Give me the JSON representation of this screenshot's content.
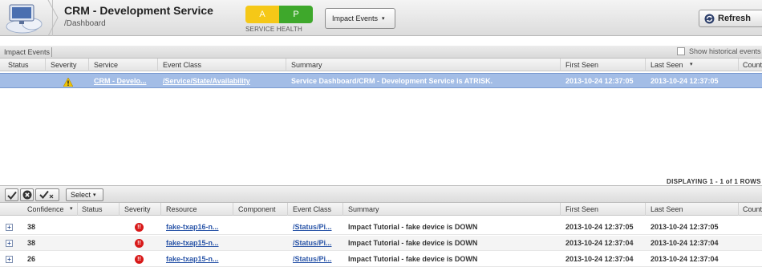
{
  "header": {
    "title": "CRM - Development Service",
    "subtitle": "/Dashboard",
    "health": {
      "a": "A",
      "p": "P",
      "label": "SERVICE HEALTH",
      "a_color": "#f5c817",
      "p_color": "#3ea82b"
    },
    "impact_button": "Impact Events",
    "refresh_button": "Refresh"
  },
  "events": {
    "section_title": "Impact Events",
    "historical_label": "Show historical events",
    "columns": [
      "Status",
      "Severity",
      "Service",
      "Event Class",
      "Summary",
      "First Seen",
      "Last Seen",
      "Count"
    ],
    "rows": [
      {
        "service": "CRM - Develo...",
        "event_class": "/Service/State/Availability",
        "summary": "Service Dashboard/CRM - Development Service is ATRISK.",
        "first_seen": "2013-10-24 12:37:05",
        "last_seen": "2013-10-24 12:37:05",
        "severity_icon": "warning-icon"
      }
    ],
    "paging": "DISPLAYING 1 - 1 of 1 ROWS"
  },
  "detail": {
    "select_button": "Select",
    "columns": [
      "Confidence",
      "Status",
      "Severity",
      "Resource",
      "Component",
      "Event Class",
      "Summary",
      "First Seen",
      "Last Seen",
      "Count"
    ],
    "rows": [
      {
        "confidence": "38",
        "resource": "fake-txap16-n...",
        "event_class": "/Status/Pi...",
        "summary": "Impact Tutorial - fake device is DOWN",
        "first_seen": "2013-10-24 12:37:05",
        "last_seen": "2013-10-24 12:37:05"
      },
      {
        "confidence": "38",
        "resource": "fake-txap15-n...",
        "event_class": "/Status/Pi...",
        "summary": "Impact Tutorial - fake device is DOWN",
        "first_seen": "2013-10-24 12:37:04",
        "last_seen": "2013-10-24 12:37:04"
      },
      {
        "confidence": "26",
        "resource": "fake-txap15-n...",
        "event_class": "/Status/Pi...",
        "summary": "Impact Tutorial - fake device is DOWN",
        "first_seen": "2013-10-24 12:37:04",
        "last_seen": "2013-10-24 12:37:04"
      }
    ]
  }
}
